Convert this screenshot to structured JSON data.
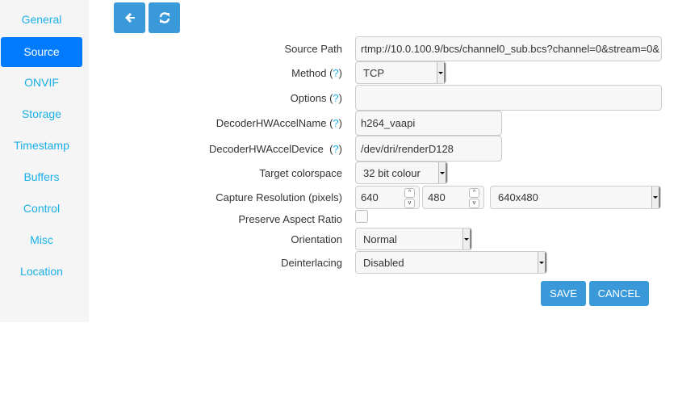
{
  "sidebar": {
    "items": [
      "General",
      "Source",
      "ONVIF",
      "Storage",
      "Timestamp",
      "Buffers",
      "Control",
      "Misc",
      "Location"
    ],
    "active": "Source"
  },
  "toolbar": {
    "back_icon": "arrow-left-icon",
    "refresh_icon": "refresh-icon"
  },
  "form": {
    "source_path": {
      "label": "Source Path",
      "value": "rtmp://10.0.100.9/bcs/channel0_sub.bcs?channel=0&stream=0&"
    },
    "method": {
      "label": "Method (",
      "help": "?",
      "close": ")",
      "value": "TCP"
    },
    "options": {
      "label": "Options (",
      "help": "?",
      "close": ")",
      "value": ""
    },
    "decoder_name": {
      "label": "DecoderHWAccelName (",
      "help": "?",
      "close": ")",
      "value": "h264_vaapi"
    },
    "decoder_device": {
      "label": "DecoderHWAccelDevice  (",
      "help": "?",
      "close": ")",
      "value": "/dev/dri/renderD128"
    },
    "colorspace": {
      "label": "Target colorspace",
      "value": "32 bit colour"
    },
    "capture": {
      "label": "Capture Resolution (pixels)",
      "width": "640",
      "height": "480",
      "preset": "640x480"
    },
    "preserve": {
      "label": "Preserve Aspect Ratio",
      "checked": false
    },
    "orientation": {
      "label": "Orientation",
      "value": "Normal"
    },
    "deinterlacing": {
      "label": "Deinterlacing",
      "value": "Disabled"
    }
  },
  "actions": {
    "save": "SAVE",
    "cancel": "CANCEL"
  }
}
